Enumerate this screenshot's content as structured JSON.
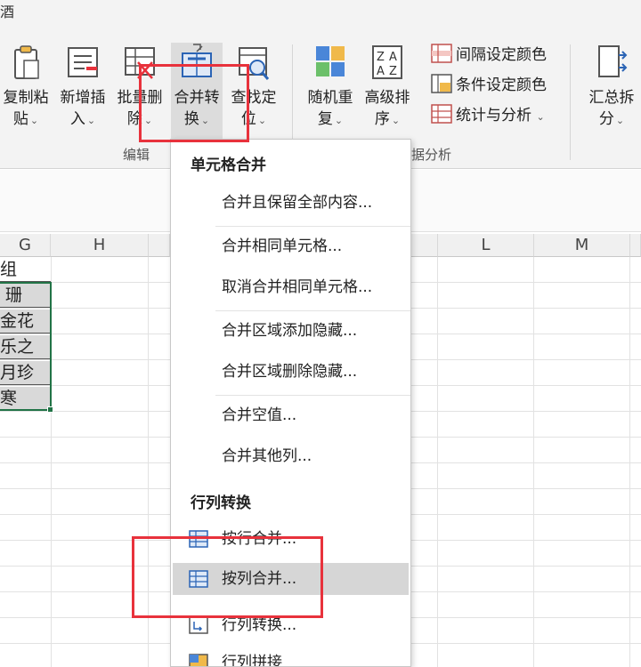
{
  "ribbon": {
    "tab_fragment": "酒",
    "buttons": [
      {
        "name": "copy-paste-button",
        "icon": "clipboard-icon",
        "line1": "复制粘",
        "line2": "贴"
      },
      {
        "name": "new-insert-button",
        "icon": "insert-rows-icon",
        "line1": "新增插",
        "line2": "入"
      },
      {
        "name": "batch-delete-button",
        "icon": "delete-grid-icon",
        "line1": "批量删",
        "line2": "除"
      },
      {
        "name": "merge-convert-button",
        "icon": "merge-grid-icon",
        "line1": "合并转",
        "line2": "换"
      },
      {
        "name": "find-locate-button",
        "icon": "magnifier-grid-icon",
        "line1": "查找定",
        "line2": "位"
      },
      {
        "name": "random-repeat-button",
        "icon": "color-tiles-icon",
        "line1": "随机重",
        "line2": "复"
      },
      {
        "name": "advanced-sort-button",
        "icon": "sort-az-icon",
        "line1": "高级排",
        "line2": "序"
      },
      {
        "name": "summary-split-button",
        "icon": "split-sheets-icon",
        "line1": "汇总拆",
        "line2": "分"
      }
    ],
    "small_buttons": [
      {
        "name": "interval-color-button",
        "label": "间隔设定颜色"
      },
      {
        "name": "condition-color-button",
        "label": "条件设定颜色"
      },
      {
        "name": "stats-analysis-button",
        "label": "统计与分析"
      }
    ],
    "groups": {
      "edit": "编辑",
      "data_analysis": "数据分析",
      "data_analysis_visible": "据分析"
    }
  },
  "sheet": {
    "columns": [
      "G",
      "H",
      "L",
      "M"
    ],
    "cells": [
      "组",
      "珊",
      "金花",
      "乐之",
      "月珍",
      "寒"
    ]
  },
  "menu": {
    "section1": "单元格合并",
    "items1": [
      "合并且保留全部内容...",
      "合并相同单元格...",
      "取消合并相同单元格...",
      "合并区域添加隐藏...",
      "合并区域删除隐藏...",
      "合并空值...",
      "合并其他列..."
    ],
    "section2": "行列转换",
    "items2": [
      "按行合并...",
      "按列合并...",
      "行列转换...",
      "行列拼接"
    ]
  },
  "colors": {
    "accent_red": "#e8323c",
    "selection_green": "#217346",
    "hover_gray": "#d6d6d6"
  }
}
